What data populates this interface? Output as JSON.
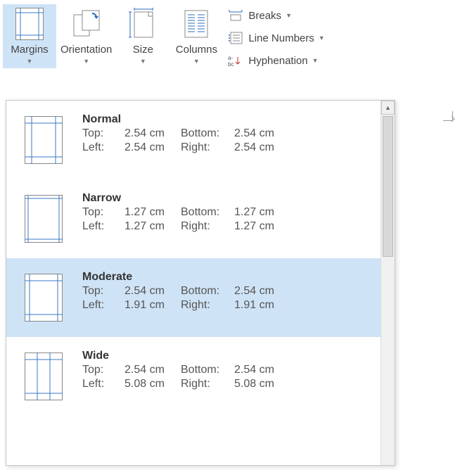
{
  "ribbon": {
    "margins": "Margins",
    "orientation": "Orientation",
    "size": "Size",
    "columns": "Columns",
    "breaks": "Breaks",
    "line_numbers": "Line Numbers",
    "hyphenation": "Hyphenation"
  },
  "labels": {
    "top": "Top:",
    "bottom": "Bottom:",
    "left": "Left:",
    "right": "Right:"
  },
  "margin_presets": [
    {
      "name": "Normal",
      "top": "2.54 cm",
      "bottom": "2.54 cm",
      "left": "2.54 cm",
      "right": "2.54 cm",
      "hover": false
    },
    {
      "name": "Narrow",
      "top": "1.27 cm",
      "bottom": "1.27 cm",
      "left": "1.27 cm",
      "right": "1.27 cm",
      "hover": false
    },
    {
      "name": "Moderate",
      "top": "2.54 cm",
      "bottom": "2.54 cm",
      "left": "1.91 cm",
      "right": "1.91 cm",
      "hover": true
    },
    {
      "name": "Wide",
      "top": "2.54 cm",
      "bottom": "2.54 cm",
      "left": "5.08 cm",
      "right": "5.08 cm",
      "hover": false
    }
  ]
}
